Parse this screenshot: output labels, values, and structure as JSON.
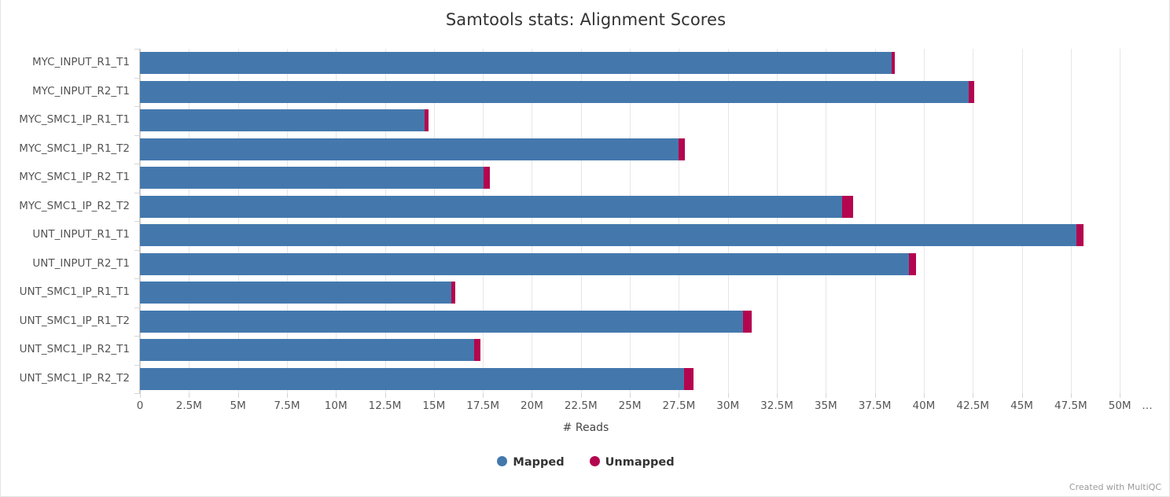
{
  "chart_data": {
    "type": "bar",
    "orientation": "horizontal",
    "stacked": true,
    "title": "Samtools stats: Alignment Scores",
    "xlabel": "# Reads",
    "ylabel": "",
    "xlim": [
      0,
      52000000
    ],
    "grid": true,
    "legend_position": "bottom",
    "categories": [
      "MYC_INPUT_R1_T1",
      "MYC_INPUT_R2_T1",
      "MYC_SMC1_IP_R1_T1",
      "MYC_SMC1_IP_R1_T2",
      "MYC_SMC1_IP_R2_T1",
      "MYC_SMC1_IP_R2_T2",
      "UNT_INPUT_R1_T1",
      "UNT_INPUT_R2_T1",
      "UNT_SMC1_IP_R1_T1",
      "UNT_SMC1_IP_R1_T2",
      "UNT_SMC1_IP_R2_T1",
      "UNT_SMC1_IP_R2_T2"
    ],
    "series": [
      {
        "name": "Mapped",
        "color": "#4478ad",
        "values": [
          38350000,
          42300000,
          14530000,
          27490000,
          17530000,
          35820000,
          47770000,
          39230000,
          15870000,
          30760000,
          17050000,
          27770000
        ]
      },
      {
        "name": "Unmapped",
        "color": "#b4054f",
        "values": [
          160000,
          280000,
          200000,
          320000,
          320000,
          570000,
          360000,
          360000,
          240000,
          450000,
          320000,
          490000
        ]
      }
    ],
    "xticks": [
      0,
      2500000,
      5000000,
      7500000,
      10000000,
      12500000,
      15000000,
      17500000,
      20000000,
      22500000,
      25000000,
      27500000,
      30000000,
      32500000,
      35000000,
      37500000,
      40000000,
      42500000,
      45000000,
      47500000,
      50000000
    ],
    "xticklabels": [
      "0",
      "2.5M",
      "5M",
      "7.5M",
      "10M",
      "12.5M",
      "15M",
      "17.5M",
      "20M",
      "22.5M",
      "25M",
      "27.5M",
      "30M",
      "32.5M",
      "35M",
      "37.5M",
      "40M",
      "42.5M",
      "45M",
      "47.5M",
      "50M"
    ],
    "xtick_overflow_label": "…"
  },
  "footer": {
    "credit": "Created with MultiQC"
  },
  "colors": {
    "mapped": "#4478ad",
    "unmapped": "#b4054f",
    "grid": "#e6e6e6",
    "axis": "#cccccc",
    "text": "#555555"
  }
}
